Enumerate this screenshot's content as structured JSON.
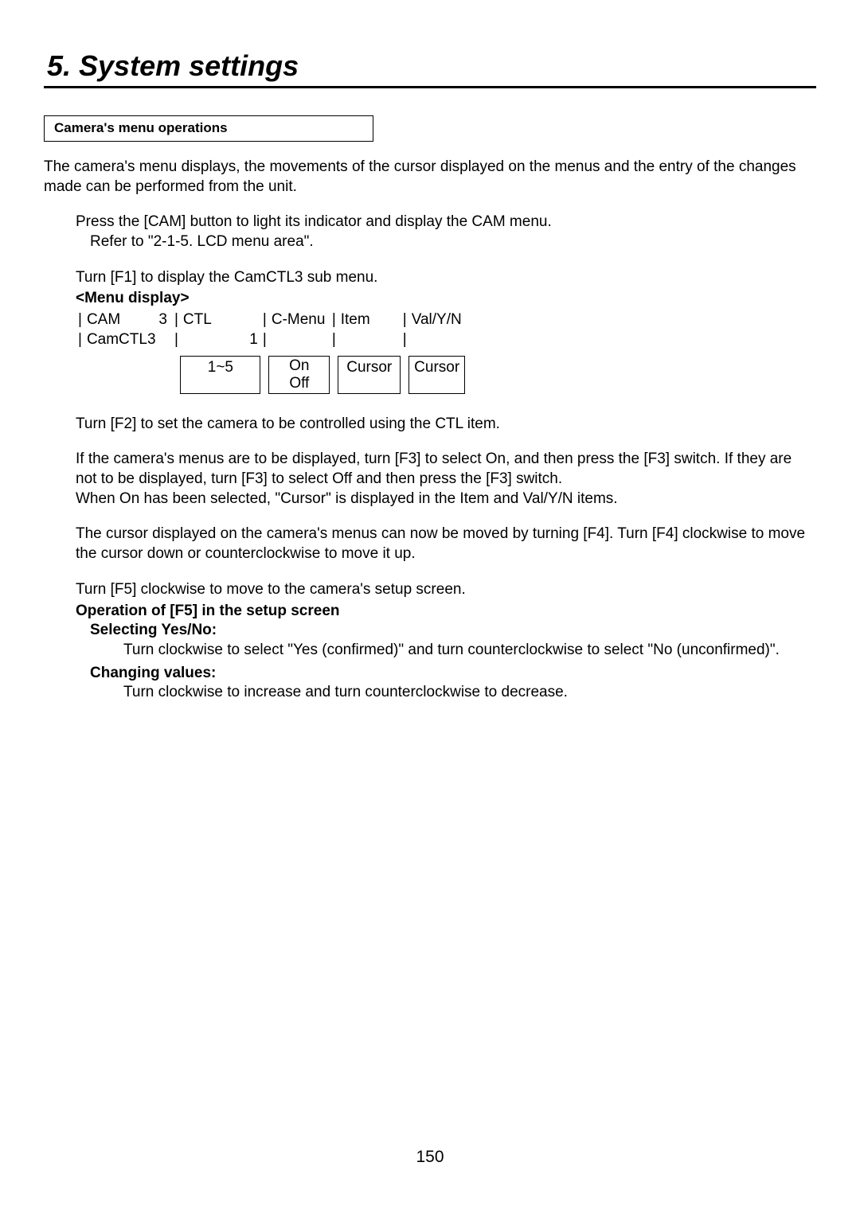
{
  "title": "5. System settings",
  "sectionBox": "Camera's menu operations",
  "intro": "The camera's menu displays, the movements of the cursor displayed on the menus and the entry of the changes made can be performed from the unit.",
  "step1_line1": "Press the [CAM] button to light its indicator and display the CAM menu.",
  "step1_line2": "Refer to \"2-1-5. LCD menu area\".",
  "step2": "Turn [F1] to display the CamCTL3 sub menu.",
  "menuLabel": "<Menu display>",
  "menu": {
    "r1": {
      "col1": "CAM",
      "col2": "3",
      "col3": "CTL",
      "col4": "C-Menu",
      "col5": "Item",
      "col6": "Val/Y/N"
    },
    "r2": {
      "col1": "CamCTL3",
      "col3": "1"
    },
    "opts": {
      "ctl": "1~5",
      "cmenu_on": "On",
      "cmenu_off": "Off",
      "item": "Cursor",
      "val": "Cursor"
    }
  },
  "pipe": "|",
  "step3": "Turn [F2] to set the camera to be controlled using the CTL item.",
  "step4_l1": "If the camera's menus are to be displayed, turn [F3] to select On, and then press the [F3] switch. If they are not to be displayed, turn [F3] to select Off and then press the [F3] switch.",
  "step4_l2": "When On has been selected, \"Cursor\" is displayed in the Item and Val/Y/N items.",
  "step5": "The cursor displayed on the camera's menus can now be moved by turning [F4]. Turn [F4] clockwise to move the cursor down or counterclockwise to move it up.",
  "step6": "Turn [F5] clockwise to move to the camera's setup screen.",
  "f5_heading": "Operation of [F5] in the setup screen",
  "f5_sel_label": "Selecting Yes/No:",
  "f5_sel_body": "Turn clockwise to select \"Yes (confirmed)\" and turn counterclockwise to select \"No (unconfirmed)\".",
  "f5_chg_label": "Changing values:",
  "f5_chg_body": "Turn clockwise to increase and turn counterclockwise to decrease.",
  "pageNumber": "150"
}
